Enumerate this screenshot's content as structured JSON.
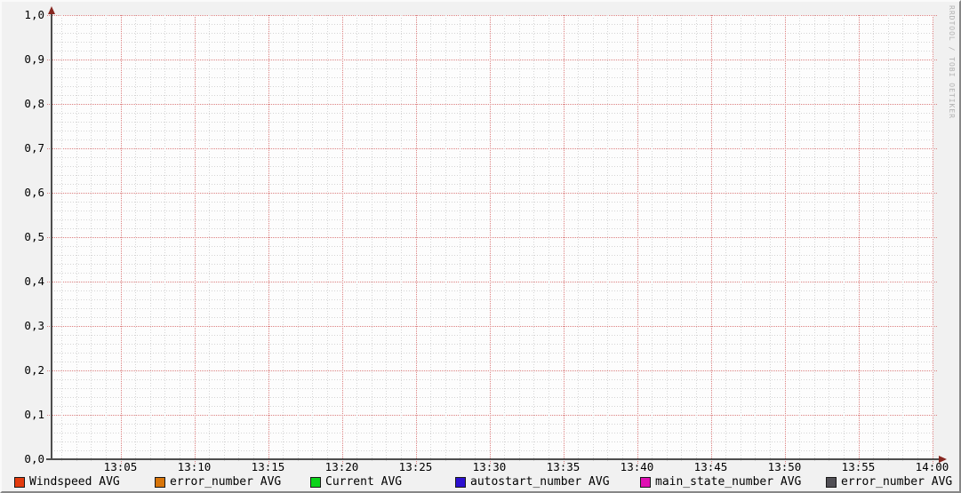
{
  "watermark": "RRDTOOL / TOBI OETIKER",
  "colors": {
    "minor_grid": "#d4d4d4",
    "major_grid": "#dc8181",
    "axis": "#4e4e4e",
    "arrow": "#872720",
    "plot_background": "#fdfdfd",
    "frame_background": "#f1f1f1"
  },
  "legend": {
    "items": [
      {
        "label": "Windspeed AVG",
        "color": "#e33b0e"
      },
      {
        "label": "error_number AVG",
        "color": "#d8750a"
      },
      {
        "label": "Current AVG",
        "color": "#0bd31a"
      },
      {
        "label": "autostart_number AVG",
        "color": "#2c10cf"
      },
      {
        "label": "main_state_number AVG",
        "color": "#df10b3"
      },
      {
        "label": "error_number AVG",
        "color": "#514f55"
      }
    ]
  },
  "chart_data": {
    "type": "line",
    "title": "",
    "xlabel": "",
    "ylabel": "",
    "ylim": [
      0.0,
      1.0
    ],
    "y_tick_step": 0.1,
    "x_tick_step_minutes": 5,
    "grid": true,
    "legend_position": "bottom",
    "y_ticks": [
      "1,0",
      "0,9",
      "0,8",
      "0,7",
      "0,6",
      "0,5",
      "0,4",
      "0,3",
      "0,2",
      "0,1",
      "0,0"
    ],
    "x_ticks": [
      "13:05",
      "13:10",
      "13:15",
      "13:20",
      "13:25",
      "13:30",
      "13:35",
      "13:40",
      "13:45",
      "13:50",
      "13:55",
      "14:00"
    ],
    "visible_data": "none",
    "series": [
      {
        "name": "Windspeed AVG",
        "color": "#e33b0e",
        "values": []
      },
      {
        "name": "error_number AVG",
        "color": "#d8750a",
        "values": []
      },
      {
        "name": "Current AVG",
        "color": "#0bd31a",
        "values": []
      },
      {
        "name": "autostart_number AVG",
        "color": "#2c10cf",
        "values": []
      },
      {
        "name": "main_state_number AVG",
        "color": "#df10b3",
        "values": []
      },
      {
        "name": "error_number AVG",
        "color": "#514f55",
        "values": []
      }
    ]
  }
}
